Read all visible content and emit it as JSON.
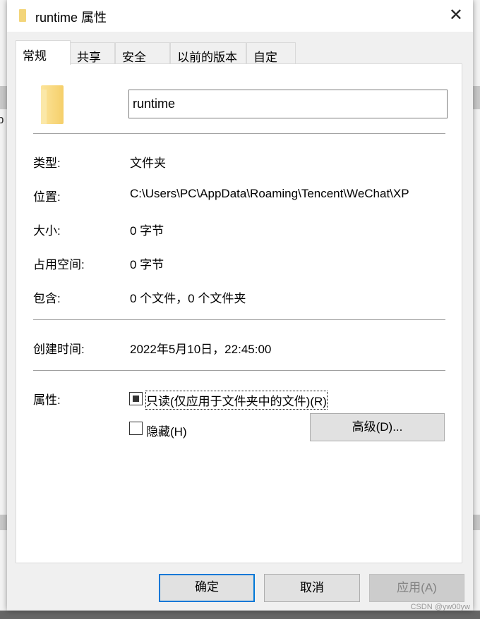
{
  "window": {
    "title": "runtime 属性",
    "close_icon": "close-icon"
  },
  "tabs": [
    {
      "label": "常规",
      "active": true
    },
    {
      "label": "共享"
    },
    {
      "label": "安全"
    },
    {
      "label": "以前的版本"
    },
    {
      "label": "自定义"
    }
  ],
  "general": {
    "name_value": "runtime",
    "rows": [
      {
        "label": "类型:",
        "value": "文件夹"
      },
      {
        "label": "位置:",
        "value": "C:\\Users\\PC\\AppData\\Roaming\\Tencent\\WeChat\\XP"
      },
      {
        "label": "大小:",
        "value": "0 字节"
      },
      {
        "label": "占用空间:",
        "value": "0 字节"
      },
      {
        "label": "包含:",
        "value": "0 个文件，0 个文件夹"
      }
    ],
    "created_label": "创建时间:",
    "created_value": "2022年5月10日，22:45:00",
    "attributes_label": "属性:",
    "readonly_label": "只读(仅应用于文件夹中的文件)(R)",
    "readonly_state": "indeterminate",
    "hidden_label": "隐藏(H)",
    "hidden_checked": false,
    "advanced_label": "高级(D)..."
  },
  "buttons": {
    "ok": "确定",
    "cancel": "取消",
    "apply": "应用(A)"
  },
  "watermark": "CSDN @yw00yw",
  "background_fragment": "p"
}
